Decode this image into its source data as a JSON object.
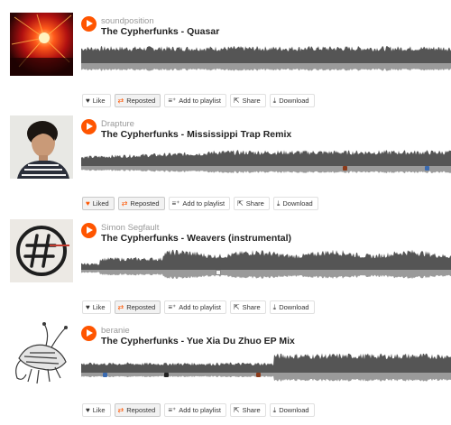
{
  "actions": {
    "like": "Like",
    "liked": "Liked",
    "reposted": "Reposted",
    "add_to_playlist": "Add to playlist",
    "share": "Share",
    "download": "Download"
  },
  "colors": {
    "accent": "#ff5500",
    "waveform": "#555555",
    "waveform_reflection": "#9a9a9a"
  },
  "tracks": [
    {
      "uploader": "soundposition",
      "title": "The Cypherfunks - Quasar",
      "liked": false,
      "artwork": "red-stage-lights-artwork"
    },
    {
      "uploader": "Drapture",
      "title": "The Cypherfunks - Mississippi Trap Remix",
      "liked": true,
      "artwork": "portrait-photo-artwork"
    },
    {
      "uploader": "Simon Segfault",
      "title": "The Cypherfunks - Weavers (instrumental)",
      "liked": false,
      "artwork": "hash-circle-logo-artwork"
    },
    {
      "uploader": "beranie",
      "title": "The Cypherfunks - Yue Xia Du Zhuo EP Mix",
      "liked": false,
      "artwork": "crayfish-sketch-artwork"
    }
  ]
}
